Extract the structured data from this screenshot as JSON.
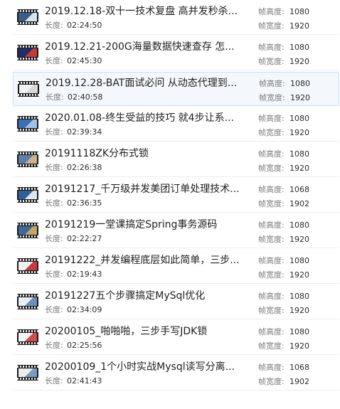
{
  "labels": {
    "duration": "长度:",
    "frame_height": "帧高度:",
    "frame_width": "帧宽度:"
  },
  "files": [
    {
      "title": "2019.12.18-双十一技术复盘 高并发秒杀...",
      "duration": "02:24:50",
      "frame_height": "1080",
      "frame_width": "1920",
      "thumb_colors": [
        "#3b5d8a",
        "#d9e4ef"
      ]
    },
    {
      "title": "2019.12.21-200G海量数据快速查存 怎...",
      "duration": "02:45:30",
      "frame_height": "1080",
      "frame_width": "1920",
      "thumb_colors": [
        "#1f2e6b",
        "#c23b3b"
      ]
    },
    {
      "title": "2019.12.28-BAT面试必问 从动态代理到...",
      "duration": "02:40:58",
      "frame_height": "1080",
      "frame_width": "1920",
      "thumb_colors": [
        "#f2f2f2",
        "#d8d8d8"
      ]
    },
    {
      "title": "2020.01.08-终生受益的技巧 就4步让系...",
      "duration": "02:39:34",
      "frame_height": "1080",
      "frame_width": "1920",
      "thumb_colors": [
        "#3a6fb5",
        "#9fc3e6"
      ]
    },
    {
      "title": "20191118ZK分布式锁",
      "duration": "02:26:38",
      "frame_height": "1080",
      "frame_width": "1920",
      "thumb_colors": [
        "#5b7fa8",
        "#c8b48a"
      ]
    },
    {
      "title": "20191217_千万级并发美团订单处理技术...",
      "duration": "02:36:35",
      "frame_height": "1068",
      "frame_width": "1902",
      "thumb_colors": [
        "#2e5f9e",
        "#e0e6ee"
      ]
    },
    {
      "title": "20191219一堂课搞定Spring事务源码",
      "duration": "02:22:27",
      "frame_height": "1080",
      "frame_width": "1920",
      "thumb_colors": [
        "#3c6a9a",
        "#c9a36a"
      ]
    },
    {
      "title": "20191222_并发编程底层如此简单，三步...",
      "duration": "02:19:43",
      "frame_height": "1080",
      "frame_width": "1920",
      "thumb_colors": [
        "#f0f0f0",
        "#c53a3a"
      ]
    },
    {
      "title": "20191227五个步骤搞定MySql优化",
      "duration": "02:34:09",
      "frame_height": "1080",
      "frame_width": "1920",
      "thumb_colors": [
        "#e8eef6",
        "#6f8fb8"
      ]
    },
    {
      "title": "20200105_啪啪啪，三步手写JDK锁",
      "duration": "02:25:56",
      "frame_height": "1080",
      "frame_width": "1920",
      "thumb_colors": [
        "#f4f4f4",
        "#d24a4a"
      ]
    },
    {
      "title": "20200109_1个小时实战Mysql读写分离...",
      "duration": "02:41:43",
      "frame_height": "1068",
      "frame_width": "1902",
      "thumb_colors": [
        "#ededed",
        "#7a9cc2"
      ]
    }
  ],
  "selected_index": 2
}
